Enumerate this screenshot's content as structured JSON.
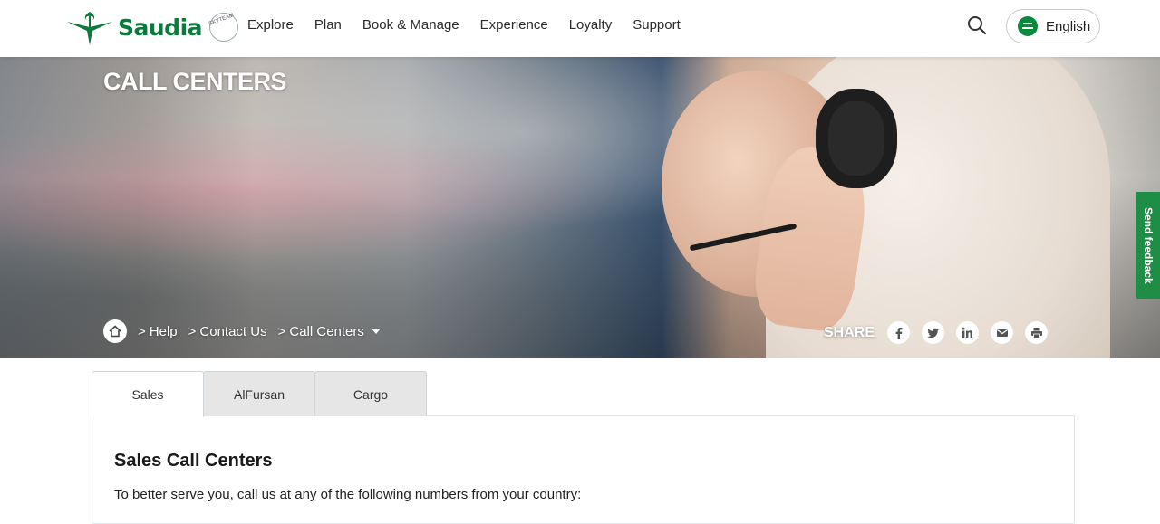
{
  "header": {
    "logo_text": "Saudia",
    "skyteam_text": "SKYTEAM",
    "nav": [
      "Explore",
      "Plan",
      "Book & Manage",
      "Experience",
      "Loyalty",
      "Support"
    ],
    "language": "English"
  },
  "hero": {
    "title": "CALL CENTERS",
    "breadcrumb": [
      "Help",
      "Contact Us",
      "Call Centers"
    ],
    "share_label": "SHARE",
    "share_icons": [
      "facebook-icon",
      "twitter-icon",
      "linkedin-icon",
      "email-icon",
      "print-icon"
    ]
  },
  "feedback_label": "Send feedback",
  "tabs": [
    "Sales",
    "AlFursan",
    "Cargo"
  ],
  "active_tab": "Sales",
  "panel": {
    "title": "Sales Call Centers",
    "text": "To better serve you, call us at any of the following numbers from your country:"
  },
  "colors": {
    "brand_green": "#0b7a3b",
    "feedback_green": "#1e8d45"
  }
}
